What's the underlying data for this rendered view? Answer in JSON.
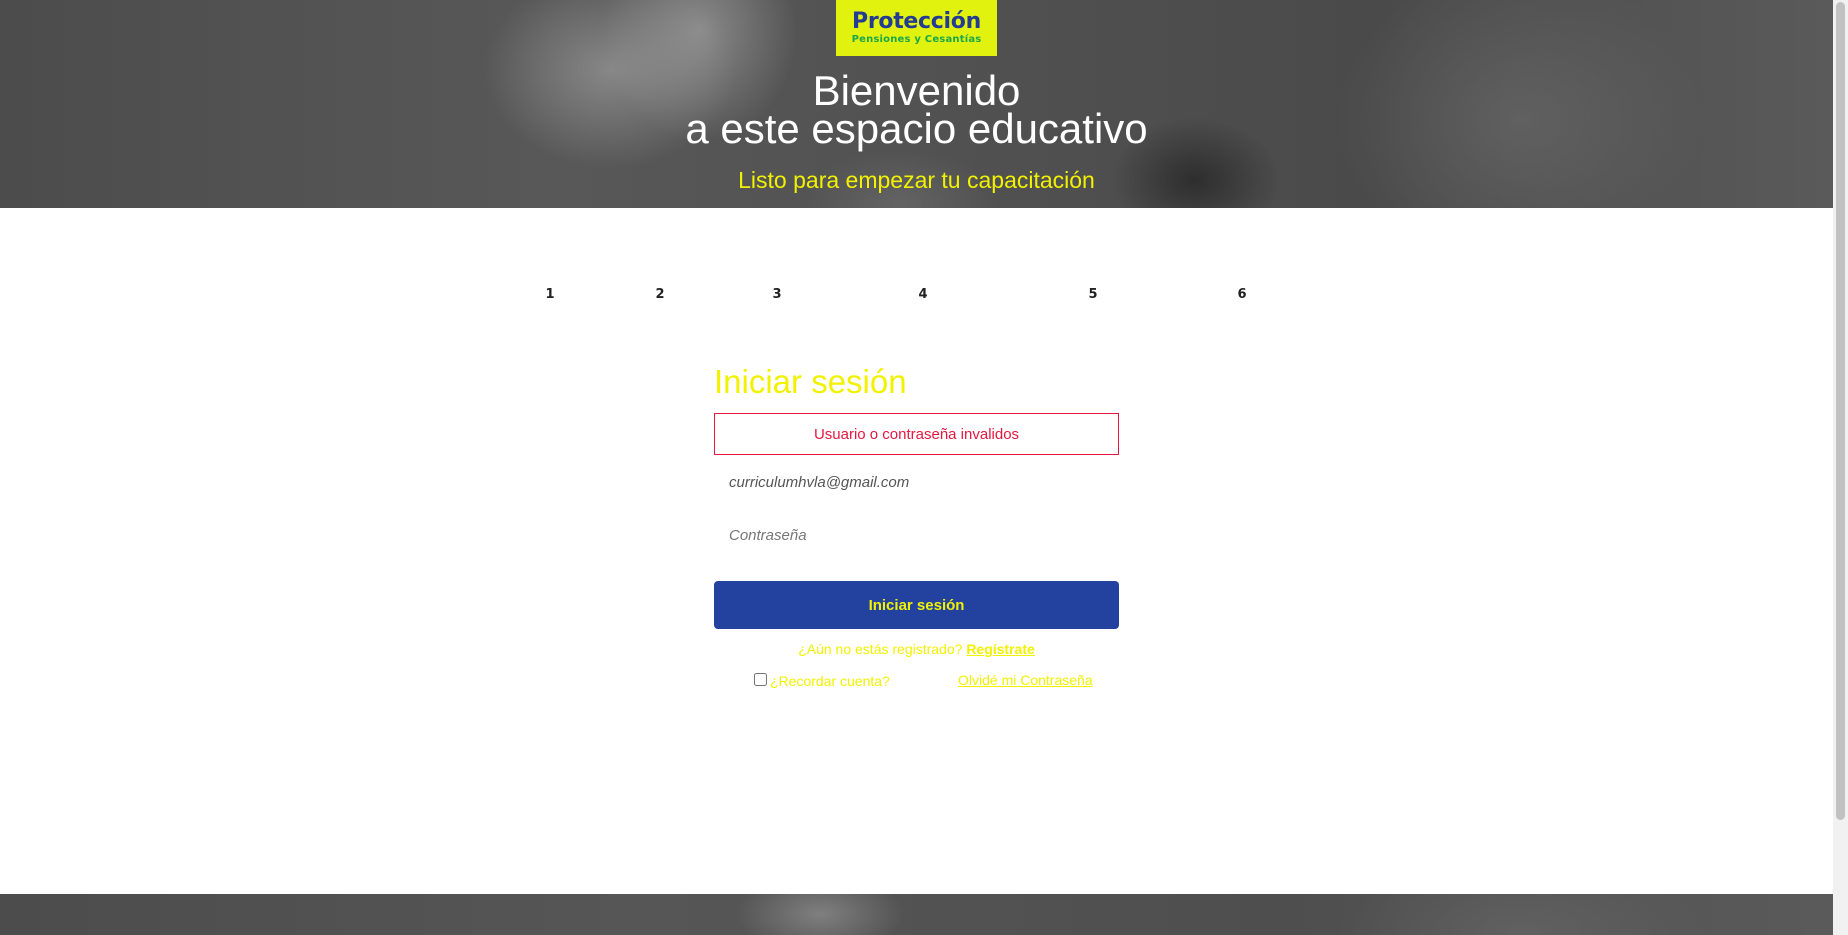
{
  "brand": {
    "name": "Protección",
    "tagline": "Pensiones y Cesantías",
    "bg_color": "#e2f20f",
    "name_color": "#233b92",
    "tagline_color": "#1aa84a"
  },
  "hero": {
    "title_line1": "Bienvenido",
    "title_line2": "a este espacio educativo",
    "subtitle": "Listo para empezar tu capacitación"
  },
  "steps": [
    "1",
    "2",
    "3",
    "4",
    "5",
    "6"
  ],
  "login": {
    "title": "Iniciar sesión",
    "error_message": "Usuario o contraseña invalidos",
    "email_value": "curriculumhvla@gmail.com",
    "password_placeholder": "Contraseña",
    "submit_label": "Iniciar sesión",
    "register_prompt": "¿Aún no estás registrado?",
    "register_link": "Regístrate",
    "remember_label": "¿Recordar cuenta?",
    "remember_checked": false,
    "forgot_link": "Olvidé mi Contraseña"
  },
  "colors": {
    "accent_yellow": "#f2f200",
    "button_blue": "#2342a0",
    "error_red": "#e5173f"
  }
}
